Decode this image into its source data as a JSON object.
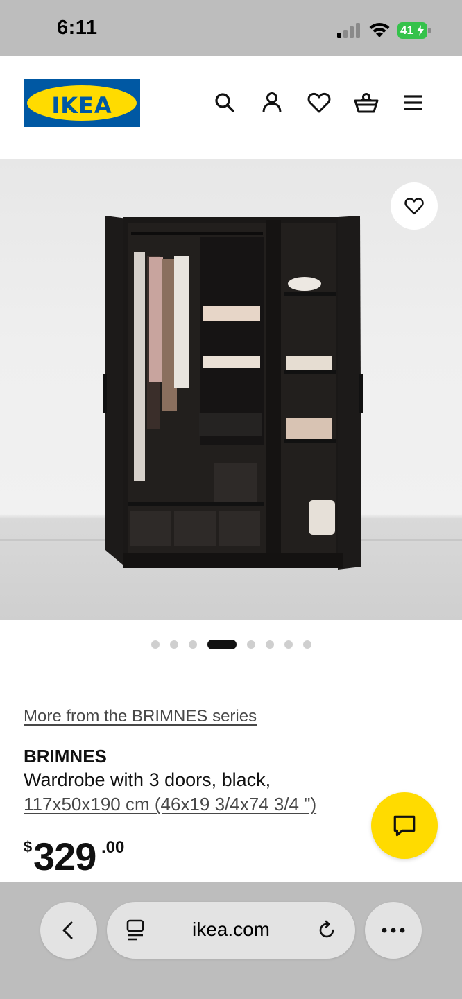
{
  "status_bar": {
    "time": "6:11",
    "battery": "41",
    "signal_bars_active": 1
  },
  "header": {
    "logo_text": "IKEA",
    "icons": [
      "search-icon",
      "account-icon",
      "favourites-icon",
      "cart-icon",
      "menu-icon"
    ]
  },
  "gallery": {
    "total_images": 8,
    "active_index": 3
  },
  "product": {
    "series_link": "More from the BRIMNES series",
    "name": "BRIMNES",
    "description": "Wardrobe with 3 doors, black,",
    "dimensions": "117x50x190 cm (46x19 3/4x74 3/4 \")",
    "price_currency": "$",
    "price_main": "329",
    "price_decimals": ".00"
  },
  "browser": {
    "url": "ikea.com"
  },
  "colors": {
    "brand_blue": "#0058a3",
    "brand_yellow": "#ffdb00",
    "battery_green": "#35c24b"
  }
}
